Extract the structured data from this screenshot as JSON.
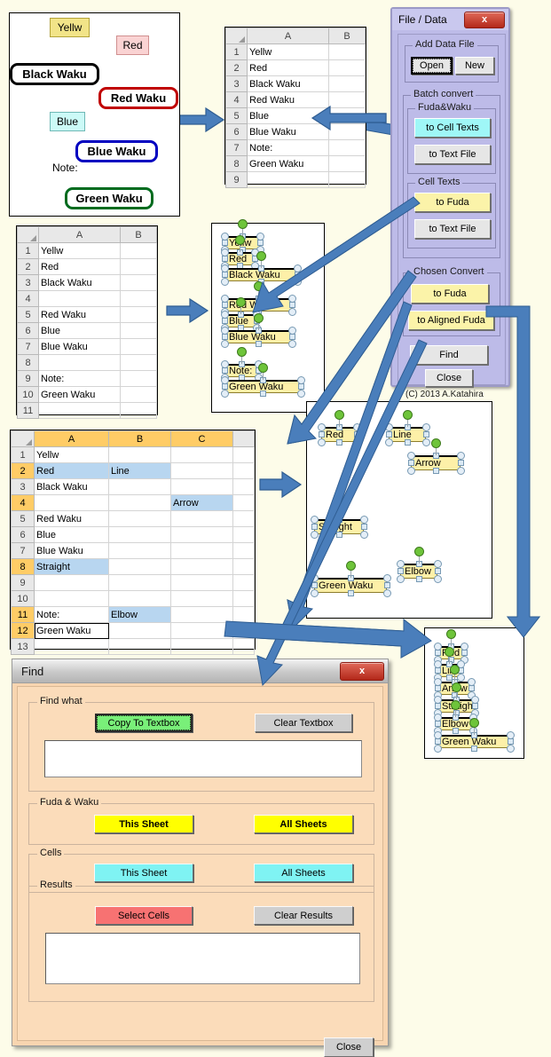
{
  "background_color": "#fdfce9",
  "accent_arrow_color": "#4a7ebb",
  "picture_panel": {
    "name": "Fuda and Waku shapes illustration",
    "fuda": [
      {
        "text": "Yellw",
        "style": "yellow"
      },
      {
        "text": "Red",
        "style": "red"
      },
      {
        "text": "Blue",
        "style": "blue"
      }
    ],
    "plain_text": "Note:",
    "waku": [
      {
        "text": "Black Waku",
        "color": "#000000"
      },
      {
        "text": "Red Waku",
        "color": "#c00000"
      },
      {
        "text": "Blue Waku",
        "color": "#0000c0"
      },
      {
        "text": "Green Waku",
        "color": "#006b1e"
      }
    ]
  },
  "sheet_top": {
    "columns": [
      "A",
      "B"
    ],
    "rows": [
      {
        "n": "1",
        "a": "Yellw",
        "b": ""
      },
      {
        "n": "2",
        "a": "Red",
        "b": ""
      },
      {
        "n": "3",
        "a": "Black Waku",
        "b": ""
      },
      {
        "n": "4",
        "a": "Red Waku",
        "b": ""
      },
      {
        "n": "5",
        "a": "Blue",
        "b": ""
      },
      {
        "n": "6",
        "a": "Blue Waku",
        "b": ""
      },
      {
        "n": "7",
        "a": "Note:",
        "b": ""
      },
      {
        "n": "8",
        "a": "Green Waku",
        "b": ""
      },
      {
        "n": "9",
        "a": "",
        "b": ""
      }
    ]
  },
  "sheet_mid": {
    "columns": [
      "A",
      "B"
    ],
    "rows": [
      {
        "n": "1",
        "a": "Yellw",
        "b": ""
      },
      {
        "n": "2",
        "a": "Red",
        "b": ""
      },
      {
        "n": "3",
        "a": "Black Waku",
        "b": ""
      },
      {
        "n": "4",
        "a": "",
        "b": ""
      },
      {
        "n": "5",
        "a": "Red Waku",
        "b": ""
      },
      {
        "n": "6",
        "a": "Blue",
        "b": ""
      },
      {
        "n": "7",
        "a": "Blue Waku",
        "b": ""
      },
      {
        "n": "8",
        "a": "",
        "b": ""
      },
      {
        "n": "9",
        "a": "Note:",
        "b": ""
      },
      {
        "n": "10",
        "a": "Green Waku",
        "b": ""
      },
      {
        "n": "11",
        "a": "",
        "b": ""
      }
    ]
  },
  "sheet_bottom": {
    "columns": [
      "A",
      "B",
      "C"
    ],
    "rows": [
      {
        "n": "1",
        "a": "Yellw",
        "b": "",
        "c": ""
      },
      {
        "n": "2",
        "a": "Red",
        "b": "Line",
        "c": ""
      },
      {
        "n": "3",
        "a": "Black Waku",
        "b": "",
        "c": ""
      },
      {
        "n": "4",
        "a": "",
        "b": "",
        "c": "Arrow"
      },
      {
        "n": "5",
        "a": "Red Waku",
        "b": "",
        "c": ""
      },
      {
        "n": "6",
        "a": "Blue",
        "b": "",
        "c": ""
      },
      {
        "n": "7",
        "a": "Blue Waku",
        "b": "",
        "c": ""
      },
      {
        "n": "8",
        "a": "Straight",
        "b": "",
        "c": ""
      },
      {
        "n": "9",
        "a": "",
        "b": "",
        "c": ""
      },
      {
        "n": "10",
        "a": "",
        "b": "",
        "c": ""
      },
      {
        "n": "11",
        "a": "Note:",
        "b": "Elbow",
        "c": ""
      },
      {
        "n": "12",
        "a": "Green Waku",
        "b": "",
        "c": ""
      },
      {
        "n": "13",
        "a": "",
        "b": "",
        "c": ""
      }
    ],
    "selected_rows": [
      "2",
      "4",
      "8",
      "11",
      "12"
    ]
  },
  "canvas_fuda": {
    "shapes": [
      "Yellw",
      "Red",
      "Black Waku",
      "Red Waku",
      "Blue",
      "Blue Waku",
      "Note:",
      "Green Waku"
    ]
  },
  "canvas_shapes": {
    "shapes": [
      "Red",
      "Line",
      "Arrow",
      "Straight",
      "Elbow",
      "Green Waku"
    ]
  },
  "canvas_aligned": {
    "shapes": [
      "Red",
      "Line",
      "Arrow",
      "Straight",
      "Elbow",
      "Green Waku"
    ]
  },
  "file_data_dialog": {
    "title": "File / Data",
    "close_glyph": "x",
    "groups": [
      {
        "label": "Add Data File",
        "buttons": [
          {
            "label": "Open",
            "style": "default-focus"
          },
          {
            "label": "New",
            "style": "default"
          }
        ]
      },
      {
        "label": "Batch convert",
        "subgroups": [
          {
            "label": "Fuda&Waku",
            "buttons": [
              {
                "label": "to Cell Texts",
                "style": "cyan"
              },
              {
                "label": "to Text File",
                "style": "default"
              }
            ]
          },
          {
            "label": "Cell Texts",
            "buttons": [
              {
                "label": "to Fuda",
                "style": "yellow"
              },
              {
                "label": "to Text File",
                "style": "default"
              }
            ]
          }
        ]
      },
      {
        "label": "Chosen Convert",
        "buttons": [
          {
            "label": "to Fuda",
            "style": "yellow"
          },
          {
            "label": "to Aligned Fuda",
            "style": "yellow"
          }
        ]
      }
    ],
    "bottom_buttons": [
      {
        "label": "Find",
        "style": "default"
      },
      {
        "label": "Close",
        "style": "default"
      }
    ],
    "copyright": "(C) 2013  A.Katahira"
  },
  "find_dialog": {
    "title": "Find",
    "close_glyph": "x",
    "groups": [
      {
        "label": "Find what",
        "buttons": [
          {
            "label": "Copy To Textbox",
            "style": "green"
          },
          {
            "label": "Clear Textbox",
            "style": "default"
          }
        ],
        "textbox_value": ""
      },
      {
        "label": "Fuda & Waku",
        "buttons": [
          {
            "label": "This Sheet",
            "style": "yellow"
          },
          {
            "label": "All Sheets",
            "style": "yellow"
          }
        ]
      },
      {
        "label": "Cells",
        "buttons": [
          {
            "label": "This Sheet",
            "style": "cyan"
          },
          {
            "label": "All Sheets",
            "style": "cyan"
          }
        ]
      },
      {
        "label": "Results",
        "buttons": [
          {
            "label": "Select Cells",
            "style": "red"
          },
          {
            "label": "Clear Results",
            "style": "default"
          }
        ],
        "textbox_value": ""
      }
    ],
    "close_button": "Close"
  }
}
